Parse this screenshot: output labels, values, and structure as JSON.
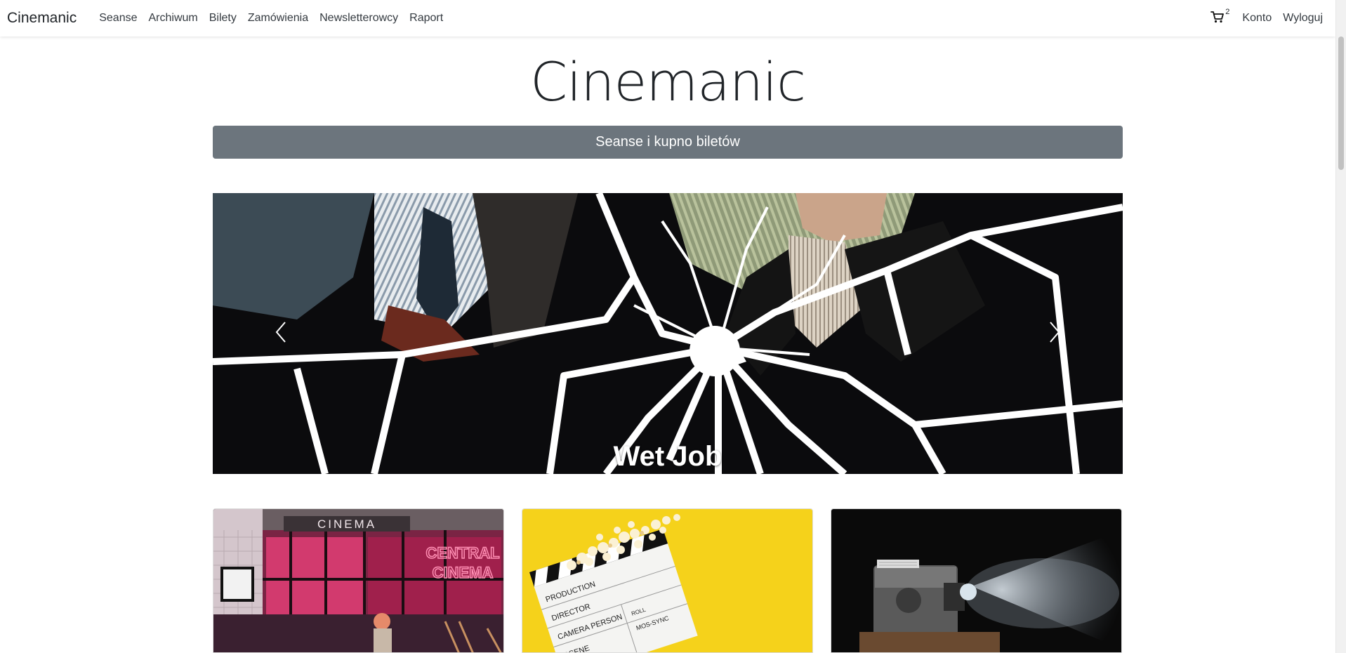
{
  "navbar": {
    "brand": "Cinemanic",
    "links": [
      "Seanse",
      "Archiwum",
      "Bilety",
      "Zamówienia",
      "Newsletterowcy",
      "Raport"
    ],
    "cart_icon": "cart-icon",
    "cart_count": "2",
    "account": "Konto",
    "logout": "Wyloguj"
  },
  "header": {
    "title": "Cinemanic",
    "button": "Seanse i kupno biletów"
  },
  "carousel": {
    "caption": "Wet Job",
    "prev_icon": "chevron-left-icon",
    "next_icon": "chevron-right-icon"
  },
  "cards": {
    "card1": {
      "sign_top": "CINEMA",
      "neon_line1": "CENTRAL",
      "neon_line2": "CINEMA"
    },
    "card2": {
      "slate_lines": [
        "PRODUCTION",
        "DIRECTOR",
        "CAMERA PERSON",
        "ROLL",
        "SCENE",
        "MOS-SYNC"
      ]
    },
    "card3": {}
  }
}
